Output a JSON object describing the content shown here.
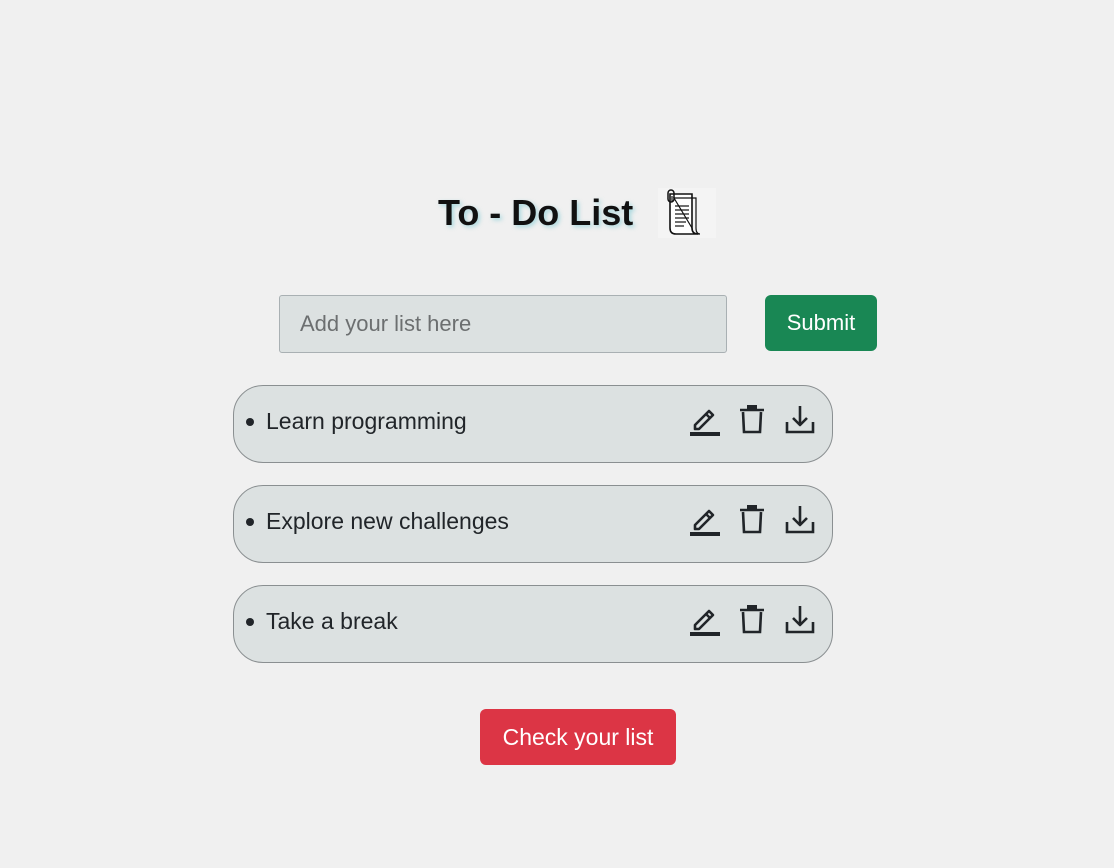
{
  "header": {
    "title": "To - Do List",
    "icon": "notepad-icon"
  },
  "form": {
    "input_placeholder": "Add your list here",
    "input_value": "",
    "submit_label": "Submit"
  },
  "todos": [
    {
      "text": "Learn programming",
      "actions": [
        "edit-icon",
        "trash-icon",
        "download-icon"
      ]
    },
    {
      "text": "Explore new challenges",
      "actions": [
        "edit-icon",
        "trash-icon",
        "download-icon"
      ]
    },
    {
      "text": "Take a break",
      "actions": [
        "edit-icon",
        "trash-icon",
        "download-icon"
      ]
    }
  ],
  "footer": {
    "check_label": "Check your list"
  },
  "colors": {
    "background": "#f0f0f0",
    "submit": "#198754",
    "check": "#dc3545",
    "item_background": "#dce1e1"
  }
}
